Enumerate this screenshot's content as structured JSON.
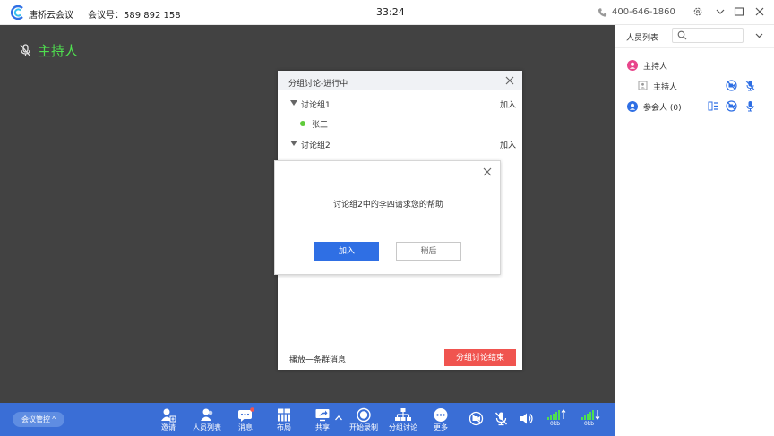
{
  "titlebar": {
    "brand": "唐桥云会议",
    "meeting_id_label": "会议号：",
    "meeting_id": "589 892 158",
    "timer": "33:24",
    "phone": "400-646-1860"
  },
  "video": {
    "host_label": "主持人"
  },
  "side_panel": {
    "title": "人员列表",
    "host_group_label": "主持人",
    "host_member": "主持人",
    "attendee_group_label": "参会人 (0)"
  },
  "breakout": {
    "title": "分组讨论-进行中",
    "groups": [
      {
        "name": "讨论组1",
        "join_label": "加入",
        "members": [
          "张三"
        ]
      },
      {
        "name": "讨论组2",
        "join_label": "加入",
        "members": []
      }
    ],
    "broadcast_label": "播放一条群消息",
    "end_label": "分组讨论结束"
  },
  "help_dialog": {
    "message": "讨论组2中的李四请求您的帮助",
    "join_label": "加入",
    "later_label": "稍后"
  },
  "toolbar": {
    "meeting_control": "会议管控 ^",
    "buttons": [
      {
        "label": "邀请",
        "icon": "invite-icon"
      },
      {
        "label": "人员列表",
        "icon": "participants-icon"
      },
      {
        "label": "消息",
        "icon": "chat-icon"
      },
      {
        "label": "布局",
        "icon": "layout-icon"
      },
      {
        "label": "共享",
        "icon": "share-screen-icon"
      },
      {
        "label": "开始录制",
        "icon": "record-icon"
      },
      {
        "label": "分组讨论",
        "icon": "breakout-icon"
      },
      {
        "label": "更多",
        "icon": "more-icon"
      }
    ],
    "upload_rate": "0kb",
    "download_rate": "0kb"
  },
  "colors": {
    "toolbar_blue": "#3a6ed6",
    "host_green": "#4fe04f",
    "end_red": "#f0544f",
    "primary_blue": "#2f6fe4",
    "video_bg": "#424242"
  }
}
